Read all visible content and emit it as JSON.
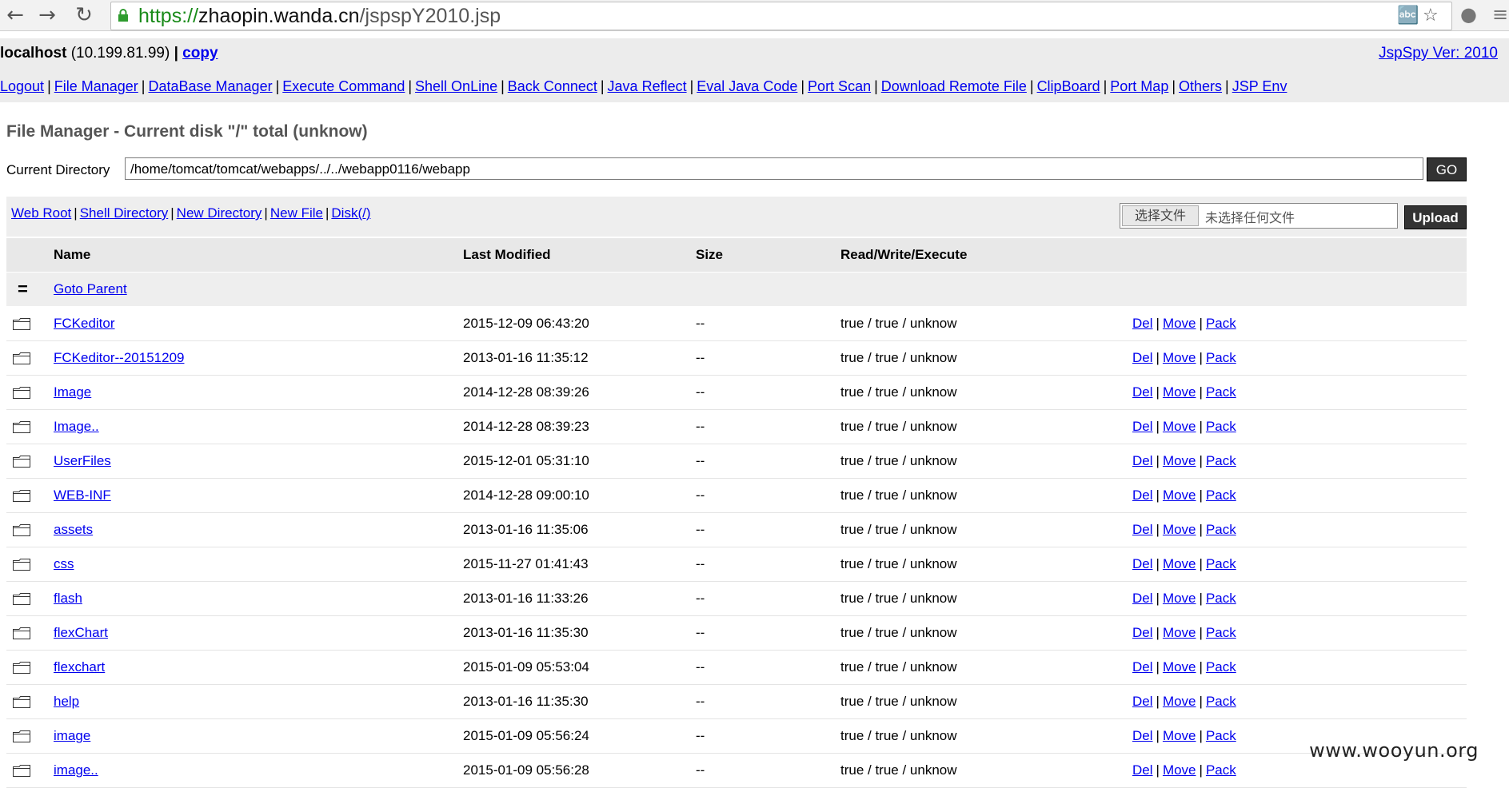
{
  "browser": {
    "url_scheme": "https://",
    "url_host": "zhaopin.wanda.cn",
    "url_path": "/jspspY2010.jsp"
  },
  "header": {
    "host": "localhost",
    "ip": "(10.199.81.99)",
    "sep": "|",
    "copy_label": "copy",
    "version_label": "JspSpy Ver: 2010"
  },
  "menu": [
    "Logout",
    "File Manager",
    "DataBase Manager",
    "Execute Command",
    "Shell OnLine",
    "Back Connect",
    "Java Reflect",
    "Eval Java Code",
    "Port Scan",
    "Download Remote File",
    "ClipBoard",
    "Port Map",
    "Others",
    "JSP Env"
  ],
  "page": {
    "title": "File Manager - Current disk \"/\" total (unknow)",
    "current_dir_label": "Current Directory",
    "current_dir_value": "/home/tomcat/tomcat/webapps/../../webapp0116/webapp",
    "go_label": "GO"
  },
  "toolbar": {
    "links": [
      "Web Root",
      "Shell Directory",
      "New Directory",
      "New File",
      "Disk(/)"
    ],
    "choose_file_label": "选择文件",
    "no_file_label": "未选择任何文件",
    "upload_label": "Upload"
  },
  "table": {
    "headers": {
      "name": "Name",
      "modified": "Last Modified",
      "size": "Size",
      "rwx": "Read/Write/Execute"
    },
    "parent_label": "Goto Parent",
    "parent_icon": "=",
    "actions": [
      "Del",
      "Move",
      "Pack"
    ],
    "rows": [
      {
        "name": "FCKeditor",
        "modified": "2015-12-09 06:43:20",
        "size": "--",
        "rwx": "true / true / unknow"
      },
      {
        "name": "FCKeditor--20151209",
        "modified": "2013-01-16 11:35:12",
        "size": "--",
        "rwx": "true / true / unknow"
      },
      {
        "name": "Image",
        "modified": "2014-12-28 08:39:26",
        "size": "--",
        "rwx": "true / true / unknow"
      },
      {
        "name": "Image..",
        "modified": "2014-12-28 08:39:23",
        "size": "--",
        "rwx": "true / true / unknow"
      },
      {
        "name": "UserFiles",
        "modified": "2015-12-01 05:31:10",
        "size": "--",
        "rwx": "true / true / unknow"
      },
      {
        "name": "WEB-INF",
        "modified": "2014-12-28 09:00:10",
        "size": "--",
        "rwx": "true / true / unknow"
      },
      {
        "name": "assets",
        "modified": "2013-01-16 11:35:06",
        "size": "--",
        "rwx": "true / true / unknow"
      },
      {
        "name": "css",
        "modified": "2015-11-27 01:41:43",
        "size": "--",
        "rwx": "true / true / unknow"
      },
      {
        "name": "flash",
        "modified": "2013-01-16 11:33:26",
        "size": "--",
        "rwx": "true / true / unknow"
      },
      {
        "name": "flexChart",
        "modified": "2013-01-16 11:35:30",
        "size": "--",
        "rwx": "true / true / unknow"
      },
      {
        "name": "flexchart",
        "modified": "2015-01-09 05:53:04",
        "size": "--",
        "rwx": "true / true / unknow"
      },
      {
        "name": "help",
        "modified": "2013-01-16 11:35:30",
        "size": "--",
        "rwx": "true / true / unknow"
      },
      {
        "name": "image",
        "modified": "2015-01-09 05:56:24",
        "size": "--",
        "rwx": "true / true / unknow"
      },
      {
        "name": "image..",
        "modified": "2015-01-09 05:56:28",
        "size": "--",
        "rwx": "true / true / unknow"
      }
    ]
  },
  "watermark": "www.wooyun.org",
  "icons": {
    "back": "back-arrow-icon",
    "forward": "forward-arrow-icon",
    "reload": "reload-icon",
    "lock": "lock-icon",
    "translate": "translate-icon",
    "star": "star-icon",
    "globe": "globe-icon",
    "menu": "menu-icon",
    "folder": "folder-icon"
  }
}
